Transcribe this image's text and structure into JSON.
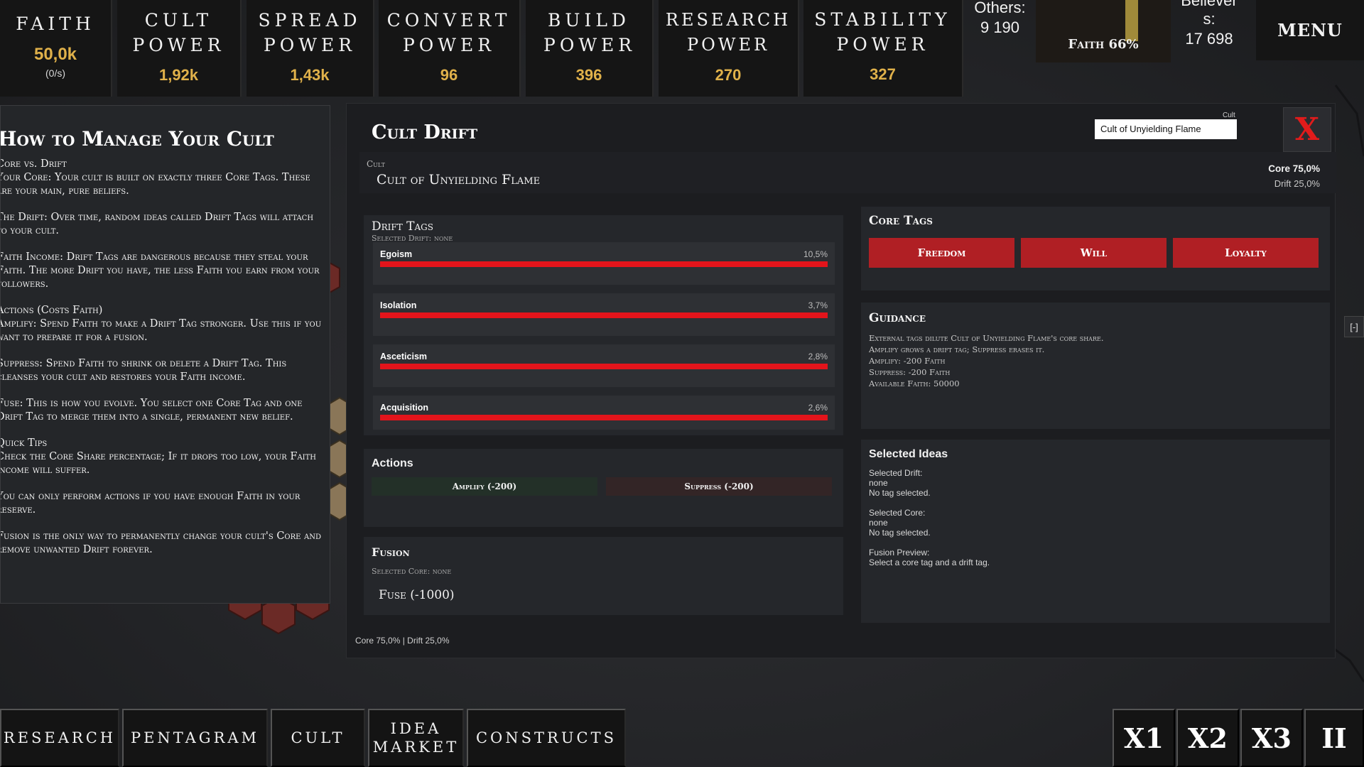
{
  "resources": {
    "faith": {
      "label": "Faith",
      "value": "50,0k",
      "rate": "(0/s)"
    },
    "cult_power": {
      "label": "Cult Power",
      "value": "1,92k"
    },
    "spread_power": {
      "label": "Spread Power",
      "value": "1,43k"
    },
    "convert_power": {
      "label": "Convert Power",
      "value": "96"
    },
    "build_power": {
      "label": "Build Power",
      "value": "396"
    },
    "research_power": {
      "label": "Research Power",
      "value": "270"
    },
    "stability_power": {
      "label": "Stability Power",
      "value": "327"
    },
    "others": {
      "label": "Others:",
      "value": "9 190"
    },
    "faith_meter": {
      "label": "Faith 66%",
      "fraction": 0.66
    },
    "believers": {
      "label": "Believer\ns:",
      "value": "17 698"
    },
    "menu": "MENU"
  },
  "help": {
    "title": "How to Manage Your Cult",
    "paragraphs": [
      "Core vs. Drift\nYour Core: Your cult is built on exactly three Core Tags. These are your main, pure beliefs.",
      "The Drift: Over time, random ideas called Drift Tags will attach to your cult.",
      "Faith Income: Drift Tags are dangerous because they steal your Faith. The more Drift you have, the less Faith you earn from your followers.",
      "Actions (Costs Faith)\nAmplify: Spend Faith to make a Drift Tag stronger. Use this if you want to prepare it for a fusion.",
      "Suppress: Spend Faith to shrink or delete a Drift Tag. This cleanses your cult and restores your Faith income.",
      "Fuse: This is how you evolve. You select one Core Tag and one Drift Tag to merge them into a single, permanent new belief.",
      "Quick Tips\nCheck the Core Share percentage;  If it drops too low, your Faith income will suffer.",
      "You can only perform actions if you have enough Faith in your reserve.",
      "Fusion is the only way to permanently change your cult's Core and remove unwanted Drift forever."
    ]
  },
  "drift": {
    "title": "Cult Drift",
    "cult_select_label": "Cult",
    "cult_select_value": "Cult of Unyielding Flame",
    "close_label": "X",
    "cult_caption": "Cult",
    "cult_name": "Cult of Unyielding Flame",
    "core_share": "Core 75,0%",
    "drift_share": "Drift 25,0%",
    "drift_tags_title": "Drift Tags",
    "selected_drift_caption": "Selected Drift: none",
    "drift_tags": [
      {
        "name": "Egoism",
        "pct": "10,5%",
        "fill": 1.0
      },
      {
        "name": "Isolation",
        "pct": "3,7%",
        "fill": 1.0
      },
      {
        "name": "Asceticism",
        "pct": "2,8%",
        "fill": 1.0
      },
      {
        "name": "Acquisition",
        "pct": "2,6%",
        "fill": 1.0
      }
    ],
    "actions_title": "Actions",
    "amplify_label": "Amplify (-200)",
    "suppress_label": "Suppress (-200)",
    "fusion_title": "Fusion",
    "selected_core_caption": "Selected Core: none",
    "fuse_label": "Fuse (-1000)",
    "footer_status": "Core 75,0% | Drift 25,0%",
    "core_tags_title": "Core Tags",
    "core_tags": [
      "Freedom",
      "Will",
      "Loyalty"
    ],
    "guidance_title": "Guidance",
    "guidance_lines": [
      "External tags dilute Cult of Unyielding Flame's core share.",
      "Amplify grows a drift tag;  Suppress erases it.",
      "Amplify: -200 Faith",
      "Suppress: -200 Faith",
      "Available Faith: 50000"
    ],
    "selected_ideas_title": "Selected Ideas",
    "selected_drift_label": "Selected Drift:",
    "selected_drift_value": "none",
    "selected_drift_desc": "No tag selected.",
    "selected_core_label": "Selected Core:",
    "selected_core_value": "none",
    "selected_core_desc": "No tag selected.",
    "fusion_preview_label": "Fusion Preview:",
    "fusion_preview_desc": "Select a core tag and a drift tag."
  },
  "side_collapse": "[-]",
  "bottom_nav": {
    "research": "RESEARCH",
    "pentagram": "PENTAGRAM",
    "cult": "CULT",
    "idea_market": "IDEA\nMARKET",
    "constructs": "CONSTRUCTS"
  },
  "speed": {
    "x1": "X1",
    "x2": "X2",
    "x3": "X3",
    "pause": "II"
  },
  "colors": {
    "accent_gold": "#e0b14a",
    "danger_red": "#e3141b",
    "tag_red": "#b01f24"
  }
}
